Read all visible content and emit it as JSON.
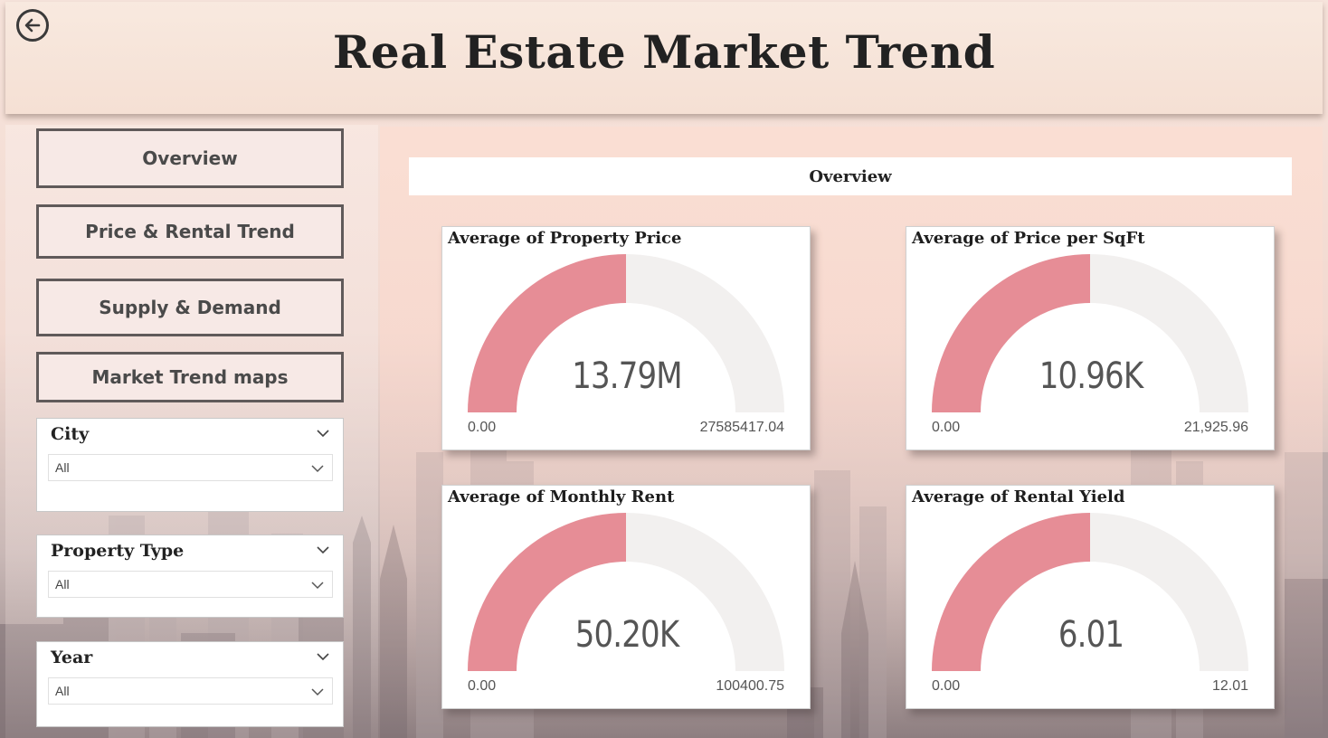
{
  "header": {
    "title": "Real Estate Market Trend"
  },
  "nav": {
    "overview": "Overview",
    "price_rental": "Price & Rental Trend",
    "supply_demand": "Supply & Demand",
    "market_maps": "Market Trend maps"
  },
  "filters": {
    "city": {
      "label": "City",
      "value": "All"
    },
    "property_type": {
      "label": "Property Type",
      "value": "All"
    },
    "year": {
      "label": "Year",
      "value": "All"
    }
  },
  "section": {
    "title": "Overview"
  },
  "colors": {
    "gauge_fill": "#e68d96",
    "gauge_track": "#f2f0ef"
  },
  "gauges": [
    {
      "title": "Average of Property Price",
      "value_label": "13.79M",
      "min_label": "0.00",
      "max_label": "27585417.04",
      "fraction": 0.5
    },
    {
      "title": "Average of Price per SqFt",
      "value_label": "10.96K",
      "min_label": "0.00",
      "max_label": "21,925.96",
      "fraction": 0.5
    },
    {
      "title": "Average of Monthly Rent",
      "value_label": "50.20K",
      "min_label": "0.00",
      "max_label": "100400.75",
      "fraction": 0.5
    },
    {
      "title": "Average of Rental Yield",
      "value_label": "6.01",
      "min_label": "0.00",
      "max_label": "12.01",
      "fraction": 0.5
    }
  ]
}
